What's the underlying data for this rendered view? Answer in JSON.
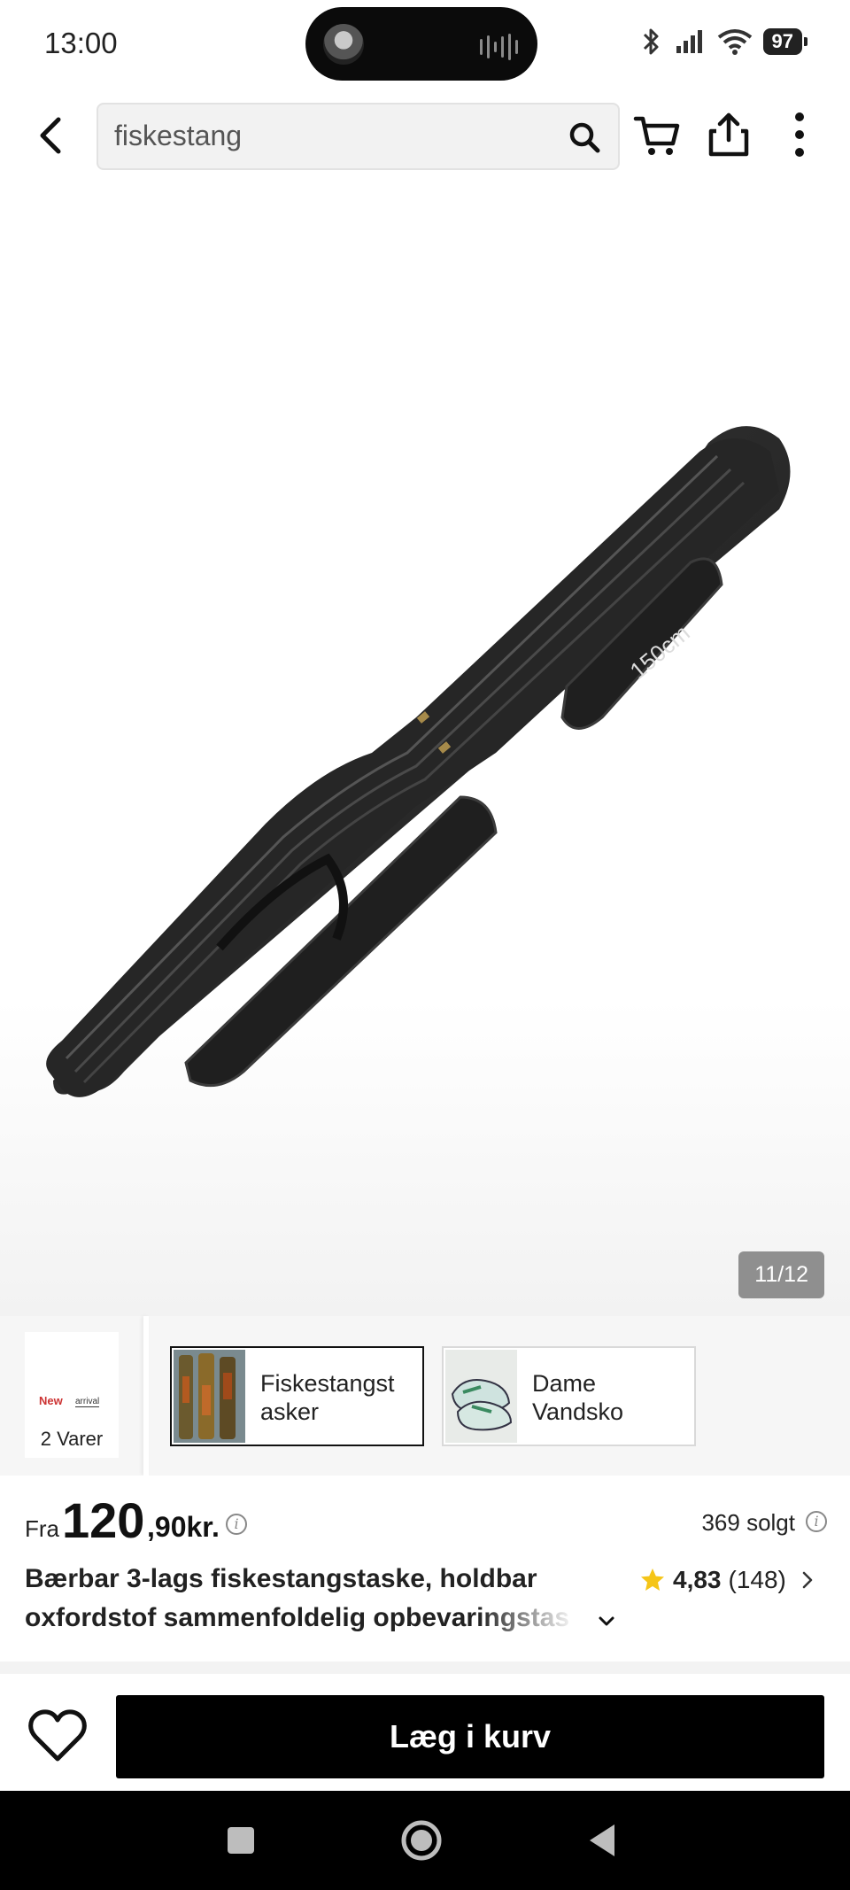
{
  "status_bar": {
    "time": "13:00",
    "battery": "97"
  },
  "header": {
    "search_value": "fiskestang"
  },
  "gallery": {
    "counter": "11/12",
    "image_text": "150cm"
  },
  "related": {
    "arrival": {
      "logo_text": "New",
      "logo_text_2": "arrival",
      "count_label": "2 Varer"
    },
    "categories": [
      {
        "label": "Fiskestangst asker",
        "active": true
      },
      {
        "label": "Dame Vandsko",
        "active": false
      }
    ]
  },
  "product": {
    "price_prefix": "Fra",
    "price_main": "120",
    "price_decimal": ",90kr.",
    "sold": "369 solgt",
    "title_line1": "Bærbar 3-lags fiskestangstaske, holdbar",
    "title_line2": "oxfordstof sammenfoldelig opbevaringstas",
    "rating": "4,83",
    "review_count": "(148)"
  },
  "actions": {
    "add_to_cart": "Læg i kurv"
  },
  "colors": {
    "accent_star": "#f5c518",
    "button_bg": "#000000"
  }
}
